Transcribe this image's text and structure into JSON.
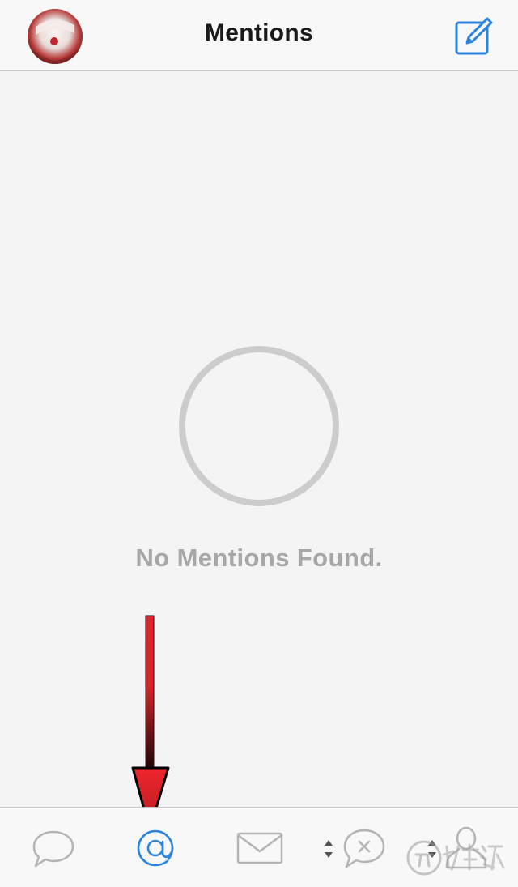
{
  "header": {
    "title": "Mentions",
    "avatar_icon": "user-avatar",
    "compose_icon": "compose-icon"
  },
  "empty_state": {
    "message": "No Mentions Found.",
    "icon": "empty-circle-icon"
  },
  "tab_bar": {
    "active_tab": "mentions",
    "accent_color": "#2a83de",
    "inactive_color": "#b4b4b4",
    "items": [
      {
        "id": "streams",
        "icon": "speech-bubble-icon"
      },
      {
        "id": "mentions",
        "icon": "at-sign-icon",
        "glyph": "@"
      },
      {
        "id": "messages",
        "icon": "envelope-icon"
      },
      {
        "id": "sort-1",
        "icon": "sort-arrows-icon"
      },
      {
        "id": "chat-x",
        "icon": "chat-x-icon"
      },
      {
        "id": "sort-2",
        "icon": "sort-arrows-icon"
      },
      {
        "id": "profile",
        "icon": "person-icon"
      }
    ]
  },
  "annotation": {
    "arrow_color": "#e0242c"
  }
}
